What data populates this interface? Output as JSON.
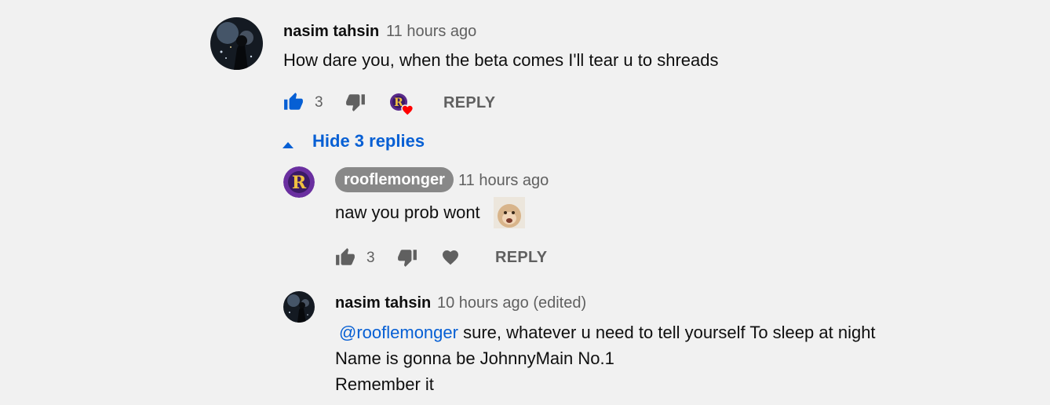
{
  "colors": {
    "background": "#f1f1f1",
    "link": "#065fd4",
    "secondary_text": "#606060",
    "like_active": "#065fd4",
    "heart": "#ff0000",
    "pill_bg": "#888888"
  },
  "comment": {
    "author": "nasim tahsin",
    "time": "11 hours ago",
    "text": "How dare you, when the beta comes I'll tear u to shreads",
    "likes": "3",
    "like_state": "liked",
    "creator_heart": true,
    "reply_label": "REPLY",
    "icons": [
      "like-icon",
      "dislike-icon",
      "creator-heart-icon"
    ]
  },
  "replies_toggle": {
    "label": "Hide 3 replies",
    "icon": "caret-up-icon"
  },
  "replies": [
    {
      "author": "rooflemonger",
      "author_is_creator": true,
      "time": "11 hours ago",
      "text": "naw you prob wont",
      "emoji": "monkey-emoji",
      "likes": "3",
      "reply_label": "REPLY",
      "icons": [
        "like-icon",
        "dislike-icon",
        "heart-icon"
      ]
    },
    {
      "author": "nasim tahsin",
      "time": "10 hours ago (edited)",
      "mention": "@rooflemonger",
      "lines": [
        " sure, whatever u need to tell yourself To sleep at night",
        "Name is gonna be JohnnyMain No.1",
        "Remember it"
      ]
    }
  ]
}
